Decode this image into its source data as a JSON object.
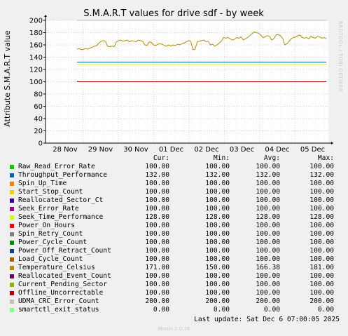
{
  "chart_data": {
    "type": "line",
    "title": "S.M.A.R.T values for drive sdf - by week",
    "ylabel": "Attribute S.M.A.R.T value",
    "ylim": [
      0,
      200
    ],
    "yticks": [
      "0",
      "20",
      "40",
      "60",
      "80",
      "100",
      "120",
      "140",
      "160",
      "180",
      "200"
    ],
    "xticks": [
      "28 Nov",
      "29 Nov",
      "30 Nov",
      "01 Dec",
      "02 Dec",
      "03 Dec",
      "04 Dec",
      "05 Dec"
    ],
    "grid": true,
    "temperature_series": [
      153,
      154,
      152,
      153,
      154,
      153,
      155,
      156,
      158,
      159,
      163,
      166,
      167,
      166,
      158,
      157,
      158,
      157,
      165,
      167,
      168,
      166,
      167,
      168,
      165,
      167,
      166,
      165,
      168,
      167,
      166,
      160,
      159,
      165,
      164,
      160,
      159,
      161,
      162,
      161,
      159,
      158,
      160,
      158,
      160,
      159,
      161,
      160,
      162,
      163,
      165,
      167,
      166,
      152,
      153,
      165,
      166,
      167,
      168,
      165,
      166,
      160,
      161,
      158,
      160,
      163,
      166,
      172,
      171,
      172,
      170,
      168,
      169,
      172,
      171,
      173,
      168,
      170,
      172,
      175,
      178,
      181,
      180,
      179,
      176,
      172,
      173,
      175,
      174,
      168,
      170,
      176,
      177,
      175,
      171,
      160,
      162,
      166,
      170,
      172,
      173,
      175,
      176,
      172,
      171,
      172,
      170,
      174,
      172,
      171,
      174,
      173,
      171,
      172,
      170
    ],
    "series": [
      {
        "name": "Raw_Read_Error_Rate",
        "color": "#00cc00",
        "cur": "100.00",
        "min": "100.00",
        "avg": "100.00",
        "max": "100.00"
      },
      {
        "name": "Throughput_Performance",
        "color": "#0066b3",
        "cur": "132.00",
        "min": "132.00",
        "avg": "132.00",
        "max": "132.00"
      },
      {
        "name": "Spin_Up_Time",
        "color": "#ff8000",
        "cur": "100.00",
        "min": "100.00",
        "avg": "100.00",
        "max": "100.00"
      },
      {
        "name": "Start_Stop_Count",
        "color": "#ffcc00",
        "cur": "100.00",
        "min": "100.00",
        "avg": "100.00",
        "max": "100.00"
      },
      {
        "name": "Reallocated_Sector_Ct",
        "color": "#330099",
        "cur": "100.00",
        "min": "100.00",
        "avg": "100.00",
        "max": "100.00"
      },
      {
        "name": "Seek_Error_Rate",
        "color": "#990099",
        "cur": "100.00",
        "min": "100.00",
        "avg": "100.00",
        "max": "100.00"
      },
      {
        "name": "Seek_Time_Performance",
        "color": "#ccff00",
        "cur": "128.00",
        "min": "128.00",
        "avg": "128.00",
        "max": "128.00"
      },
      {
        "name": "Power_On_Hours",
        "color": "#ff0000",
        "cur": "100.00",
        "min": "100.00",
        "avg": "100.00",
        "max": "100.00"
      },
      {
        "name": "Spin_Retry_Count",
        "color": "#808080",
        "cur": "100.00",
        "min": "100.00",
        "avg": "100.00",
        "max": "100.00"
      },
      {
        "name": "Power_Cycle_Count",
        "color": "#008f00",
        "cur": "100.00",
        "min": "100.00",
        "avg": "100.00",
        "max": "100.00"
      },
      {
        "name": "Power_Off_Retract_Count",
        "color": "#00487d",
        "cur": "100.00",
        "min": "100.00",
        "avg": "100.00",
        "max": "100.00"
      },
      {
        "name": "Load_Cycle_Count",
        "color": "#b35a00",
        "cur": "100.00",
        "min": "100.00",
        "avg": "100.00",
        "max": "100.00"
      },
      {
        "name": "Temperature_Celsius",
        "color": "#b38f00",
        "cur": "171.00",
        "min": "150.00",
        "avg": "166.38",
        "max": "181.00"
      },
      {
        "name": "Reallocated_Event_Count",
        "color": "#6b006b",
        "cur": "100.00",
        "min": "100.00",
        "avg": "100.00",
        "max": "100.00"
      },
      {
        "name": "Current_Pending_Sector",
        "color": "#8fb300",
        "cur": "100.00",
        "min": "100.00",
        "avg": "100.00",
        "max": "100.00"
      },
      {
        "name": "Offline_Uncorrectable",
        "color": "#b30000",
        "cur": "100.00",
        "min": "100.00",
        "avg": "100.00",
        "max": "100.00"
      },
      {
        "name": "UDMA_CRC_Error_Count",
        "color": "#bebebe",
        "cur": "200.00",
        "min": "200.00",
        "avg": "200.00",
        "max": "200.00"
      },
      {
        "name": "smartctl_exit_status",
        "color": "#80ff80",
        "cur": "0.00",
        "min": "0.00",
        "avg": "0.00",
        "max": "0.00"
      }
    ]
  },
  "legend_header": {
    "cur": "Cur:",
    "min": "Min:",
    "avg": "Avg:",
    "max": "Max:"
  },
  "footer": "Last update: Sat Dec  6 07:00:05 2025",
  "watermark": "RRDTOOL / TOBI OETIKER",
  "munin": "Munin 2.0.76"
}
